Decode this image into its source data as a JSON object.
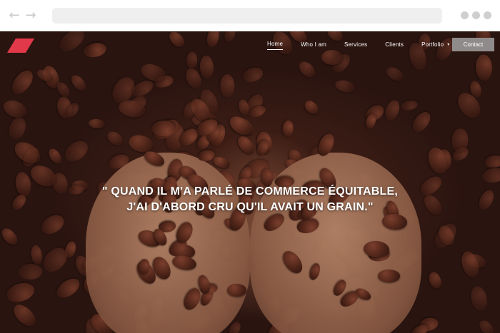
{
  "browser": {
    "back_icon": "arrow-left-icon",
    "forward_icon": "arrow-right-icon",
    "back_glyph": "←",
    "forward_glyph": "→",
    "menu_icon": "three-dots-icon"
  },
  "site": {
    "logo_icon": "red-parallelogram-logo",
    "accent_color": "#e2394a",
    "nav": {
      "items": [
        {
          "label": "Home",
          "active": true
        },
        {
          "label": "Who I am",
          "active": false
        },
        {
          "label": "Services",
          "active": false
        },
        {
          "label": "Clients",
          "active": false
        },
        {
          "label": "Portfolio",
          "active": false,
          "has_dropdown": true
        }
      ],
      "dropdown_icon": "caret-down-icon",
      "dropdown_glyph": "▾",
      "contact_label": "Contact"
    },
    "hero": {
      "quote_line1": "\" QUAND IL M'A PARLÉ DE COMMERCE ÉQUITABLE,",
      "quote_line2": "J'AI D'ABORD CRU QU'IL AVAIT UN GRAIN.\""
    }
  }
}
